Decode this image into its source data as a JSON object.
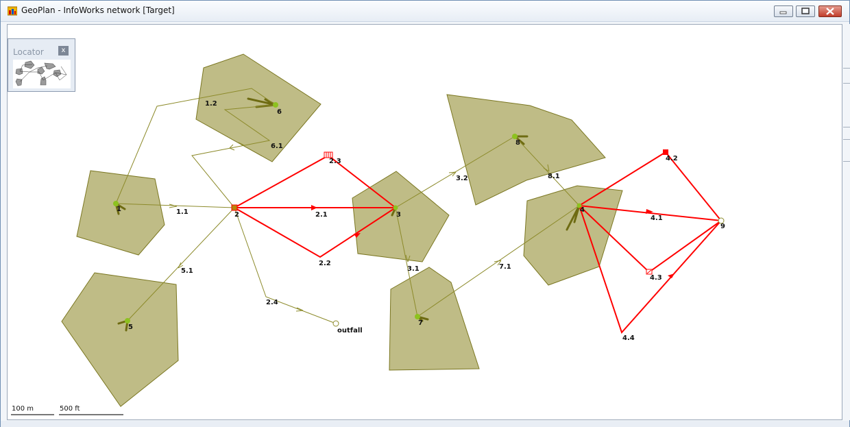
{
  "window": {
    "title": "GeoPlan - InfoWorks network [Target]",
    "icons": {
      "app": "geoplan-app-icon",
      "minimize": "minimize-icon",
      "maximize": "maximize-icon",
      "close": "close-icon"
    }
  },
  "locator": {
    "title": "Locator",
    "close_label": "x"
  },
  "scale": {
    "metric": "100 m",
    "imperial": "500 ft"
  },
  "colors": {
    "subcatchment_fill": "#a9a55d",
    "subcatchment_stroke": "#7a7620",
    "link": "#8c8a2a",
    "highlight": "#ff0000",
    "node": "#8dc21f"
  },
  "labels": {
    "n1": "1",
    "n2": "2",
    "n3": "3",
    "n4": "4",
    "n5": "5",
    "n6": "6",
    "n7": "7",
    "n8": "8",
    "n9": "9",
    "outfall": "outfall",
    "l1_1": "1.1",
    "l1_2": "1.2",
    "l2_1": "2.1",
    "l2_2": "2.2",
    "l2_3": "2.3",
    "l2_4": "2.4",
    "l3_1": "3.1",
    "l3_2": "3.2",
    "l4_1": "4.1",
    "l4_2": "4.2",
    "l4_3": "4.3",
    "l4_4": "4.4",
    "l5_1": "5.1",
    "l6_1": "6.1",
    "l7_1": "7.1",
    "l8_1": "8.1"
  }
}
